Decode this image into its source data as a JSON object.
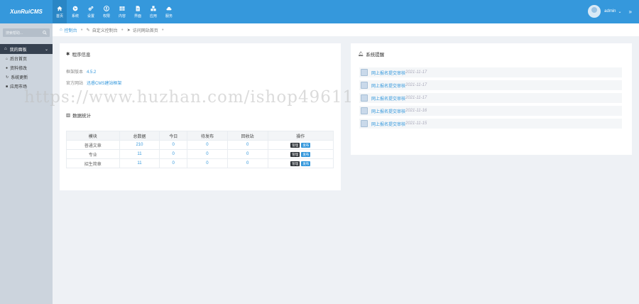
{
  "app": {
    "logo_text": "XunRuiCMS"
  },
  "nav": [
    {
      "label": "首页",
      "icon": "home-icon",
      "active": true
    },
    {
      "label": "系统",
      "icon": "globe-icon"
    },
    {
      "label": "设置",
      "icon": "cogs-icon"
    },
    {
      "label": "权限",
      "icon": "user-circle-icon"
    },
    {
      "label": "内容",
      "icon": "table-icon"
    },
    {
      "label": "界面",
      "icon": "file-icon"
    },
    {
      "label": "应用",
      "icon": "cubes-icon"
    },
    {
      "label": "服务",
      "icon": "cloud-icon"
    }
  ],
  "user": {
    "name": "admin"
  },
  "sidebar": {
    "search_placeholder": "搜索帮助...",
    "menu_title": "我的面板",
    "items": [
      {
        "label": "后台首页",
        "icon": "home-icon"
      },
      {
        "label": "资料修改",
        "icon": "user-icon"
      },
      {
        "label": "系统更新",
        "icon": "refresh-icon"
      },
      {
        "label": "应用市场",
        "icon": "cube-icon"
      }
    ]
  },
  "breadcrumb": [
    {
      "label": "控制台",
      "icon": "home-icon"
    },
    {
      "label": "自定义控制台",
      "icon": "edit-icon"
    },
    {
      "label": "访问网站首页",
      "icon": "send-icon"
    }
  ],
  "program_info": {
    "title": "程序信息",
    "version_label": "框架版本",
    "version": "4.5.2",
    "site_label": "官方网站",
    "site": "迅睿CMS建站框架"
  },
  "stats": {
    "title": "数据统计",
    "headers": [
      "模块",
      "总数据",
      "今日",
      "待发布",
      "回收站",
      "操作"
    ],
    "rows": [
      {
        "module": "普通文章",
        "total": "210",
        "today": "0",
        "pending": "0",
        "recycle": "0"
      },
      {
        "module": "专业",
        "total": "11",
        "today": "0",
        "pending": "0",
        "recycle": "0"
      },
      {
        "module": "招生简章",
        "total": "11",
        "today": "0",
        "pending": "0",
        "recycle": "0"
      }
    ],
    "manage_label": "管理",
    "publish_label": "发布"
  },
  "system_notices": {
    "title": "系统提醒",
    "items": [
      {
        "text": "网上报名提交审核",
        "date": "2021-11-17"
      },
      {
        "text": "网上报名提交审核",
        "date": "2021-11-17"
      },
      {
        "text": "网上报名提交审核",
        "date": "2021-11-17"
      },
      {
        "text": "网上报名提交审核",
        "date": "2021-11-16"
      },
      {
        "text": "网上报名提交审核",
        "date": "2021-11-15"
      }
    ]
  },
  "watermark": "https://www.huzhan.com/ishop49611",
  "colors": {
    "topbar": "#3598dc",
    "sidebar": "#ccd4dd",
    "sidebar_active": "#364150",
    "accent": "#3598dc"
  }
}
